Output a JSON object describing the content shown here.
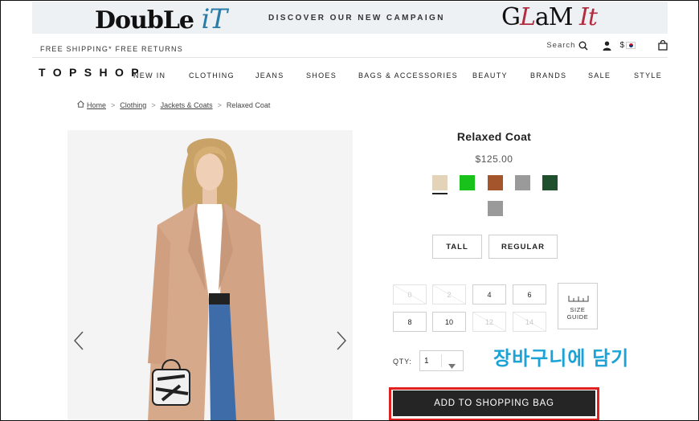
{
  "promo": {
    "left_logo_main": "DoubLe ",
    "left_logo_accent": "iT",
    "campaign_text": "DISCOVER OUR NEW CAMPAIGN",
    "right_logo_g": "G",
    "right_logo_l": "L",
    "right_logo_a": "a",
    "right_logo_m": "M ",
    "right_logo_it": "It"
  },
  "utility": {
    "shipping": "FREE SHIPPING* FREE RETURNS",
    "search_label": "Search",
    "currency": "$",
    "icons": [
      "search-icon",
      "account-icon",
      "korea-flag-icon",
      "shopping-bag-icon"
    ]
  },
  "brand": "TOPSHOP",
  "nav": {
    "items": [
      "NEW IN",
      "CLOTHING",
      "JEANS",
      "SHOES",
      "BAGS & ACCESSORIES",
      "BEAUTY",
      "BRANDS",
      "SALE",
      "STYLE"
    ]
  },
  "breadcrumb": {
    "items": [
      "Home",
      "Clothing",
      "Jackets & Coats"
    ],
    "separator": ">",
    "current": "Relaxed Coat"
  },
  "product": {
    "title": "Relaxed Coat",
    "price": "$125.00",
    "swatches": [
      "#e3d3b8",
      "#19c21a",
      "#a4552b",
      "#9a9a9a",
      "#1f4f2c",
      "#9a9a9a"
    ],
    "selected_swatch": 0,
    "fit_options": [
      "TALL",
      "REGULAR"
    ],
    "sizes": [
      {
        "label": "0",
        "available": false
      },
      {
        "label": "2",
        "available": false
      },
      {
        "label": "4",
        "available": true
      },
      {
        "label": "6",
        "available": true
      },
      {
        "label": "8",
        "available": true
      },
      {
        "label": "10",
        "available": true
      },
      {
        "label": "12",
        "available": false
      },
      {
        "label": "14",
        "available": false
      }
    ],
    "size_guide_line1": "SIZE",
    "size_guide_line2": "GUIDE",
    "qty_label": "QTY:",
    "qty_value": "1",
    "add_to_bag": "ADD TO SHOPPING BAG"
  },
  "annotation": {
    "text": "장바구니에 담기",
    "color": "#1ba3d6",
    "highlight_color": "#e01f1f"
  }
}
